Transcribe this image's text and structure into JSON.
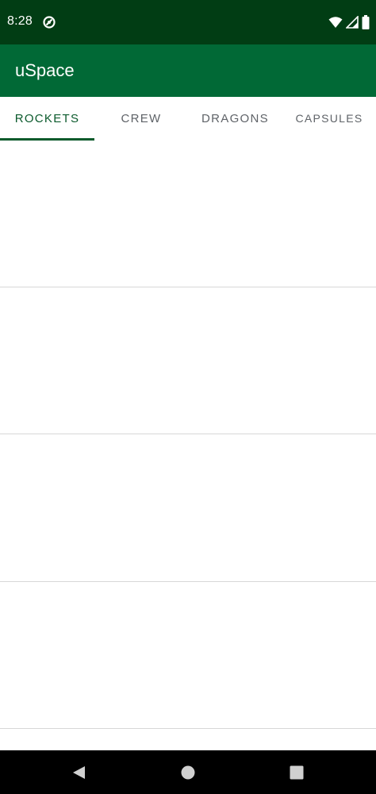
{
  "status_bar": {
    "time": "8:28",
    "background_color": "#013d14",
    "icons": [
      "notification-icon",
      "wifi-icon",
      "signal-icon",
      "battery-icon"
    ]
  },
  "app_bar": {
    "title": "uSpace",
    "background_color": "#016936"
  },
  "tabs": [
    {
      "label": "ROCKETS",
      "selected": true
    },
    {
      "label": "CREW",
      "selected": false
    },
    {
      "label": "DRAGONS",
      "selected": false
    },
    {
      "label": "CAPSULES",
      "selected": false
    }
  ],
  "accent_color": "#0b5a2c",
  "nav_bar": {
    "icons": [
      "back-icon",
      "home-icon",
      "recents-icon"
    ]
  }
}
